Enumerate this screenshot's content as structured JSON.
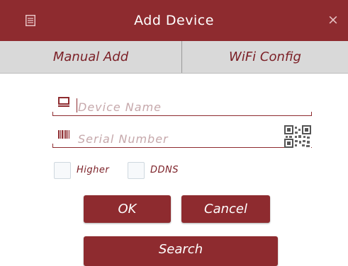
{
  "header": {
    "title": "Add Device",
    "menu_icon": "list-icon",
    "close_icon": "close-icon",
    "close_glyph": "×",
    "bg_color": "#8e2b2f"
  },
  "tabs": [
    {
      "label": "Manual Add",
      "active": true
    },
    {
      "label": "WiFi Config",
      "active": false
    }
  ],
  "form": {
    "device_name_placeholder": "Device Name",
    "serial_number_placeholder": "Serial Number",
    "device_icon": "monitor-icon",
    "serial_icon": "barcode-icon",
    "qr_icon": "qr-code-icon"
  },
  "options": [
    {
      "label": "Higher",
      "checked": false
    },
    {
      "label": "DDNS",
      "checked": false
    }
  ],
  "buttons": {
    "ok": "OK",
    "cancel": "Cancel",
    "search": "Search"
  },
  "colors": {
    "accent": "#8e2b2f",
    "tab_bg": "#d9d9d9",
    "placeholder": "#c6a8ab"
  }
}
